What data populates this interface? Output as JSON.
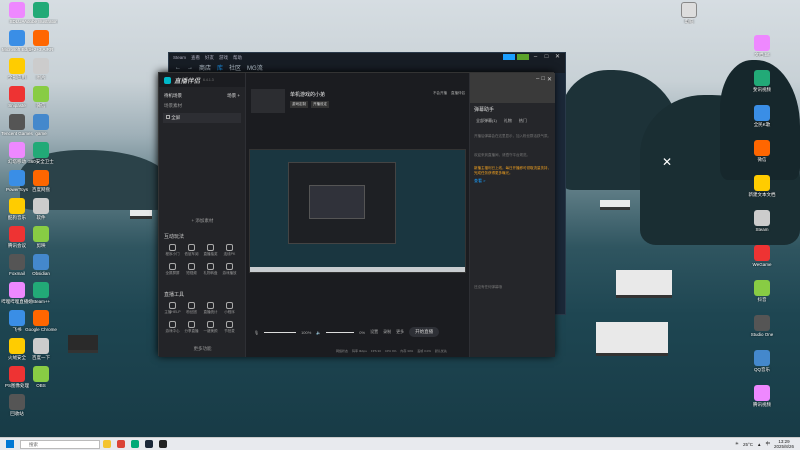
{
  "desktop": {
    "left_icons": [
      {
        "label": "SDLUA"
      },
      {
        "label": "Adobe Illustrator 2024"
      },
      {
        "label": "Microsoft Edge"
      },
      {
        "label": "1+2+3 AIRR"
      },
      {
        "label": "全部应用"
      },
      {
        "label": "图片"
      },
      {
        "label": "Snipaste"
      },
      {
        "label": "微信"
      },
      {
        "label": "Tencent Games"
      },
      {
        "label": "game"
      },
      {
        "label": "幻塔移动"
      },
      {
        "label": "360安全卫士"
      },
      {
        "label": "PowerToys"
      },
      {
        "label": "百度网盘"
      },
      {
        "label": "酷狗音乐"
      },
      {
        "label": "软件"
      },
      {
        "label": "腾讯会议"
      },
      {
        "label": "剪映"
      },
      {
        "label": "Foxmail"
      },
      {
        "label": "Obsidian"
      },
      {
        "label": "哔哩哔哩直播姬"
      },
      {
        "label": "Steam++"
      },
      {
        "label": "飞书"
      },
      {
        "label": "Google Chrome"
      },
      {
        "label": "火绒安全"
      },
      {
        "label": "百度一下"
      },
      {
        "label": "PS图像处理"
      },
      {
        "label": "OBS"
      },
      {
        "label": "回收站"
      }
    ],
    "right_icons": [
      {
        "label": "文档.txt"
      },
      {
        "label": "斐讯视频"
      },
      {
        "label": "全民K歌"
      },
      {
        "label": "微信"
      },
      {
        "label": "新建文本文档"
      },
      {
        "label": "Steam"
      },
      {
        "label": "WeGame"
      },
      {
        "label": "抖音"
      },
      {
        "label": "Studio One"
      },
      {
        "label": "QQ音乐"
      },
      {
        "label": "腾讯视频"
      }
    ],
    "top_right_icon": {
      "label": "电脑"
    }
  },
  "steam": {
    "menu": [
      "Steam",
      "查看",
      "好友",
      "游戏",
      "帮助"
    ],
    "nav": [
      "商店",
      "库",
      "社区",
      "MG流"
    ],
    "active_index": 1
  },
  "zhibo": {
    "app_title": "直播伴侣",
    "version": "6.4.1.3",
    "left": {
      "scene_title": "待机场景",
      "tab_scene": "场景",
      "tab_add": "+",
      "list_head": "场景素材",
      "source_item": "全屏",
      "add_source": "+ 添加素材",
      "interact_title": "互动玩法",
      "interact_tools": [
        "程序小门",
        "低屁车阅",
        "直播抽奖",
        "连线PK",
        "全屏屏屏",
        "短视频",
        "礼物转盘",
        "游戏播放"
      ],
      "admin_title": "直播工具",
      "admin_tools": [
        "主播HELP",
        "粉丝团",
        "直播统计",
        "小程序",
        "游戏中心",
        "分享直播",
        "一键美颜",
        "节拍麦"
      ],
      "more": "更多功能"
    },
    "mid": {
      "stream_title": "单机游戏的小弟",
      "tag1": "游戏定制",
      "tag2": "开播设定",
      "header_btns": [
        "不会开播",
        "直播伴侣"
      ],
      "mic_label": "麦克风",
      "speaker_label": "扬声器",
      "mic_pct": "100%",
      "speaker_pct": "0%",
      "btn_settings": "设置",
      "btn_record": "录制",
      "btn_more": "更多",
      "start_btn": "开始直播",
      "status": [
        "网络状态",
        "码率 0kbps",
        "FPS 30",
        "CPU 9%",
        "内存 34%",
        "丢帧 0.0%",
        "默认优先"
      ]
    },
    "right": {
      "title": "弹幕助手",
      "tabs": [
        "全部弹幕(1)",
        "礼物",
        "热门"
      ],
      "tip1": "开播后弹幕会在这里显示，加入粉丝群活跃气氛。",
      "tip2": "欢迎来到直播间，请遵守平台规范。",
      "notice": "新播主福利已上线，每日开播即可领取流量扶持，完成任务获得更多曝光。",
      "link": "查看 >",
      "footer": "还没有任何弹幕哦"
    }
  },
  "taskbar": {
    "search_placeholder": "搜索",
    "weather": "25°C",
    "tray_lang": "中",
    "time": "13:29",
    "date": "2025/8/26"
  },
  "colors": {
    "accent": "#00b8c8",
    "steam_blue": "#1a9fff",
    "notice": "#f0a020"
  }
}
